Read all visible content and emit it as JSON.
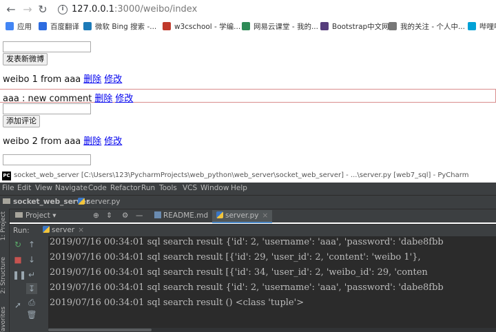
{
  "browser": {
    "url_host": "127.0.0.1",
    "url_rest": ":3000/weibo/index",
    "bookmarks": [
      {
        "label": "应用",
        "color": "#4285f4"
      },
      {
        "label": "百度翻译",
        "color": "#2d6ce0"
      },
      {
        "label": "微软 Bing 搜索 -...",
        "color": "#1c7ab8"
      },
      {
        "label": "w3cschool - 学编...",
        "color": "#c0392b"
      },
      {
        "label": "网易云课堂 - 我的...",
        "color": "#2e8b57"
      },
      {
        "label": "Bootstrap中文网",
        "color": "#563d7c"
      },
      {
        "label": "我的关注 - 个人中...",
        "color": "#777777"
      },
      {
        "label": "哔哩哔",
        "color": "#00a1d6"
      }
    ]
  },
  "page": {
    "publish_button": "发表新微博",
    "weibos": [
      {
        "text": "weibo 1 from aaa",
        "delete": "删除",
        "edit": "修改"
      },
      {
        "text": "weibo 2 from aaa",
        "delete": "删除",
        "edit": "修改"
      }
    ],
    "comment": {
      "text": "aaa : new comment",
      "delete": "删除",
      "edit": "修改"
    },
    "add_comment_button": "添加评论"
  },
  "pycharm": {
    "title": "socket_web_server [C:\\Users\\123\\PycharmProjects\\web_python\\web_server\\socket_web_server] - ...\\server.py [web7_sql] - PyCharm",
    "logo": "PC",
    "menu": [
      "File",
      "Edit",
      "View",
      "Navigate",
      "Code",
      "Refactor",
      "Run",
      "Tools",
      "VCS",
      "Window",
      "Help"
    ],
    "breadcrumb": {
      "project": "socket_web_server",
      "file": "server.py"
    },
    "project_dropdown": "Project",
    "tabs": [
      {
        "label": "README.md",
        "active": false
      },
      {
        "label": "server.py",
        "active": true
      }
    ],
    "side_labels": [
      "1: Project",
      "2: Structure",
      "Favorites"
    ],
    "run_label": "Run:",
    "run_tab": "server",
    "console_lines": [
      "2019/07/16 00:34:01 sql search result {'id': 2, 'username': 'aaa', 'password': 'dabe8fbb",
      "2019/07/16 00:34:01 sql search result [{'id': 29, 'user_id': 2, 'content': 'weibo 1'},",
      "2019/07/16 00:34:01 sql search result [{'id': 34, 'user_id': 2, 'weibo_id': 29, 'conten",
      "2019/07/16 00:34:01 sql search result {'id': 2, 'username': 'aaa', 'password': 'dabe8fbb",
      "2019/07/16 00:34:01 sql search result () <class 'tuple'>"
    ]
  }
}
